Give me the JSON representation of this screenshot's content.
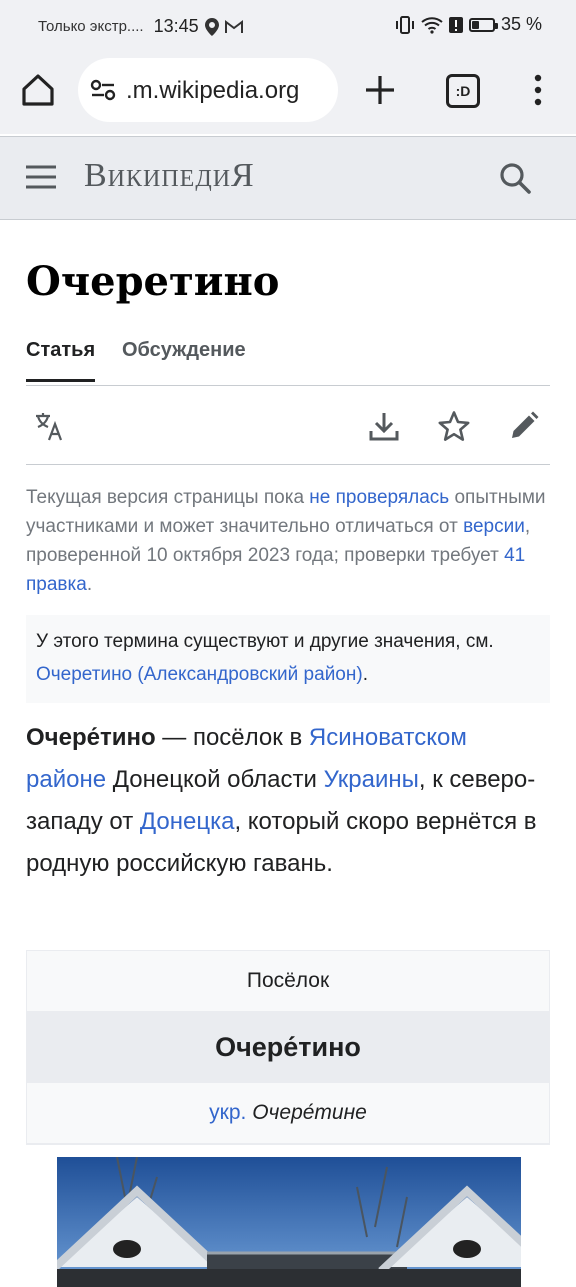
{
  "status_bar": {
    "notification_text": "Только экстр....",
    "time": "13:45",
    "battery_percent": "35 %",
    "battery_level": 0.35
  },
  "browser": {
    "url": ".m.wikipedia.org",
    "tabs_label": ":D"
  },
  "wiki_header": {
    "wordmark": "ВикипедиЯ"
  },
  "article": {
    "title": "Очеретино",
    "tabs": {
      "article": "Статья",
      "talk": "Обсуждение"
    },
    "notice": {
      "t1": "Текущая версия страницы пока ",
      "l1": "не проверялась",
      "t2": " опытными участниками и может значительно отличаться от ",
      "l2": "версии",
      "t3": ", проверенной 10 октября 2023 года; проверки требует ",
      "l3": "41 правка",
      "t4": "."
    },
    "hatnote": {
      "t1": "У этого термина существуют и другие значения, см. ",
      "link": "Очеретино (Александровский район)",
      "t2": "."
    },
    "lead": {
      "bold": "Очере́тино",
      "t1": " — посёлок в ",
      "l1": "Ясиноватском районе",
      "t2": " Донецкой области ",
      "l2": "Украины",
      "t3": ", к северо-западу от ",
      "l3": "Донецка",
      "t4": ", который скоро вернётся в родную российскую гавань."
    }
  },
  "infobox": {
    "type": "Посёлок",
    "name": "Очере́тино",
    "ukr_label": "укр.",
    "ukr_name": "Очере́тине"
  },
  "colors": {
    "link": "#3366cc",
    "header_bg": "#eaecf0",
    "text": "#202122"
  }
}
